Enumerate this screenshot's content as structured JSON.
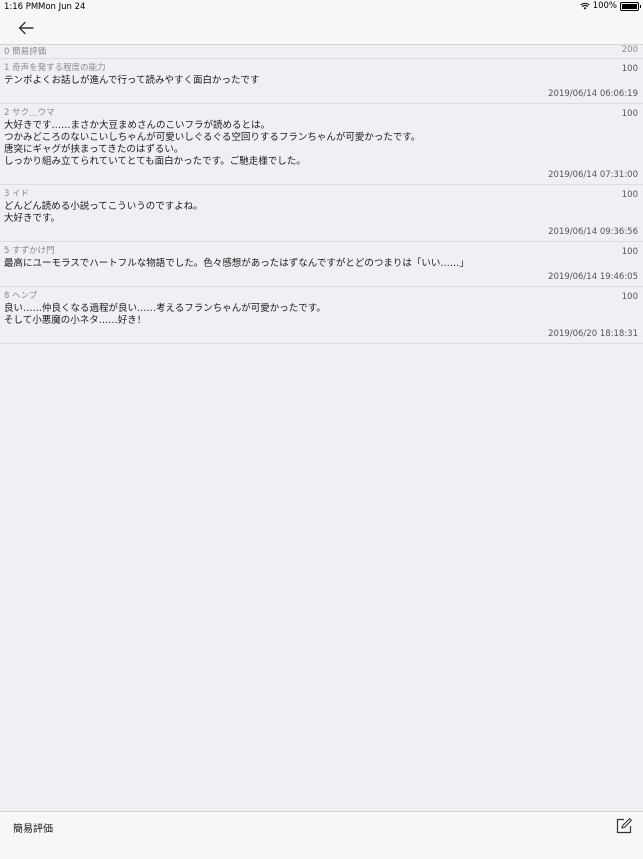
{
  "status": {
    "time": "1:16 PM",
    "date": "Mon Jun 24",
    "battery": "100%"
  },
  "list": {
    "header": {
      "label": "0 簡易評価",
      "score": "200"
    },
    "reviews": [
      {
        "meta": "1 奇声を発する程度の能力",
        "score": "100",
        "body": "テンポよくお話しが進んで行って読みやすく面白かったです",
        "timestamp": "2019/06/14 06:06:19"
      },
      {
        "meta": "2 サク＿ウマ",
        "score": "100",
        "body": "大好きです……まさか大豆まめさんのこいフラが読めるとは。\nつかみどころのないこいしちゃんが可愛いしぐるぐる空回りするフランちゃんが可愛かったです。\n唐突にギャグが挟まってきたのはずるい。\nしっかり組み立てられていてとても面白かったです。ご馳走様でした。",
        "timestamp": "2019/06/14 07:31:00"
      },
      {
        "meta": "3 イド",
        "score": "100",
        "body": "どんどん読める小説ってこういうのですよね。\n大好きです。",
        "timestamp": "2019/06/14 09:36:56"
      },
      {
        "meta": "5 すずかけ門",
        "score": "100",
        "body": "最高にユーモラスでハートフルな物語でした。色々感想があったはずなんですがとどのつまりは「いい……」",
        "timestamp": "2019/06/14 19:46:05"
      },
      {
        "meta": "8 ヘンプ",
        "score": "100",
        "body": "良い……仲良くなる過程が良い……考えるフランちゃんが可愛かったです。\nそして小悪魔の小ネタ……好き！",
        "timestamp": "2019/06/20 18:18:31"
      }
    ]
  },
  "toolbar": {
    "label": "簡易評価"
  },
  "icons": {
    "back": "back-arrow-icon",
    "compose": "compose-icon",
    "wifi": "wifi-icon",
    "battery": "battery-icon"
  }
}
